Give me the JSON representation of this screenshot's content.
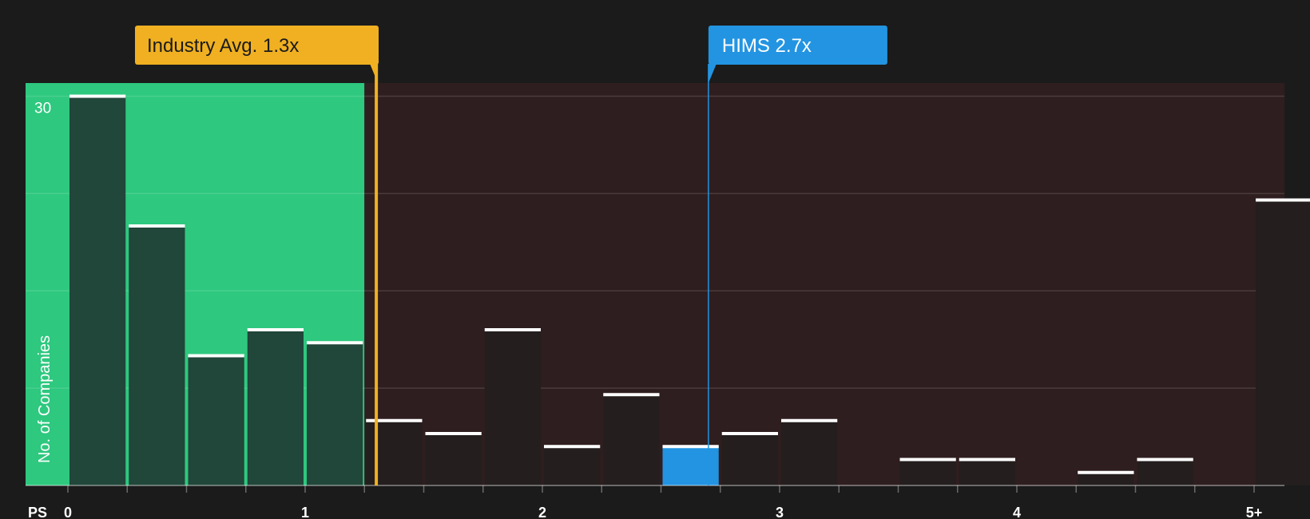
{
  "chart_data": {
    "type": "bar",
    "xlabel": "PS",
    "ylabel": "No. of Companies",
    "x_tick_labels": [
      "0",
      "1",
      "2",
      "3",
      "4",
      "5+"
    ],
    "y_tick_labels": [
      "30"
    ],
    "ylim": [
      0,
      31
    ],
    "bin_width": 0.25,
    "bins_start": [
      0,
      0.25,
      0.5,
      0.75,
      1.0,
      1.25,
      1.5,
      1.75,
      2.0,
      2.25,
      2.5,
      2.75,
      3.0,
      3.25,
      3.5,
      3.75,
      4.0,
      4.25,
      4.5,
      4.75,
      5.0
    ],
    "values": [
      30,
      20,
      10,
      12,
      11,
      5,
      4,
      12,
      3,
      7,
      3,
      4,
      5,
      0,
      2,
      2,
      0,
      1,
      2,
      0,
      22
    ],
    "highlight_bin_start": 2.5,
    "undervalued_range": [
      0,
      1.25
    ],
    "grid": true,
    "annotations": [
      {
        "label": "Industry Avg. 1.3x",
        "value": 1.3
      },
      {
        "label": "HIMS 2.7x",
        "value": 2.7
      }
    ]
  },
  "colors": {
    "background": "#1b1b1b",
    "undervalued_zone": "#2ec87f",
    "overvalued_zone": "#2f1e1f",
    "bar_in_zone": "#21463a",
    "bar_default": "#241e1e",
    "bar_highlight": "#2394e1",
    "bar_top": "#ffffff",
    "industry_accent": "#f0b021",
    "company_accent": "#2394e1",
    "text": "#ffffff"
  }
}
